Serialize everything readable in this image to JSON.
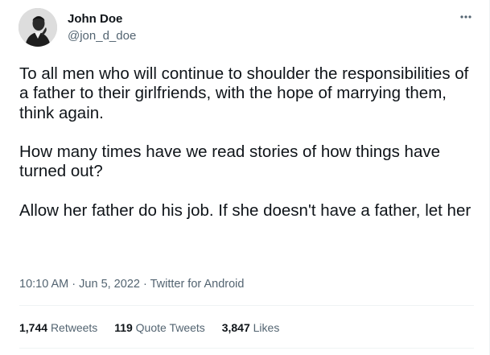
{
  "author": {
    "name": "John Doe",
    "handle": "@jon_d_doe",
    "avatar_icon": "user-avatar-photo"
  },
  "menu_icon": "more-horizontal-icon",
  "tweet": {
    "paragraphs": [
      "To all men who will continue to shoulder the responsibilities of a father to their girlfriends, with the hope of marrying them, think again.",
      "How many times have we read stories of how things have turned out?",
      "Allow her father do his job. If she doesn't have a father, let her"
    ]
  },
  "meta": {
    "time": "10:10 AM",
    "separator1": " · ",
    "date": "Jun 5, 2022",
    "separator2": " · ",
    "source": "Twitter for Android"
  },
  "stats": {
    "retweets": {
      "count": "1,744",
      "label": "Retweets"
    },
    "quotes": {
      "count": "119",
      "label": "Quote Tweets"
    },
    "likes": {
      "count": "3,847",
      "label": "Likes"
    }
  },
  "colors": {
    "text": "#0f1419",
    "secondary": "#536471",
    "divider": "#eff3f4"
  }
}
